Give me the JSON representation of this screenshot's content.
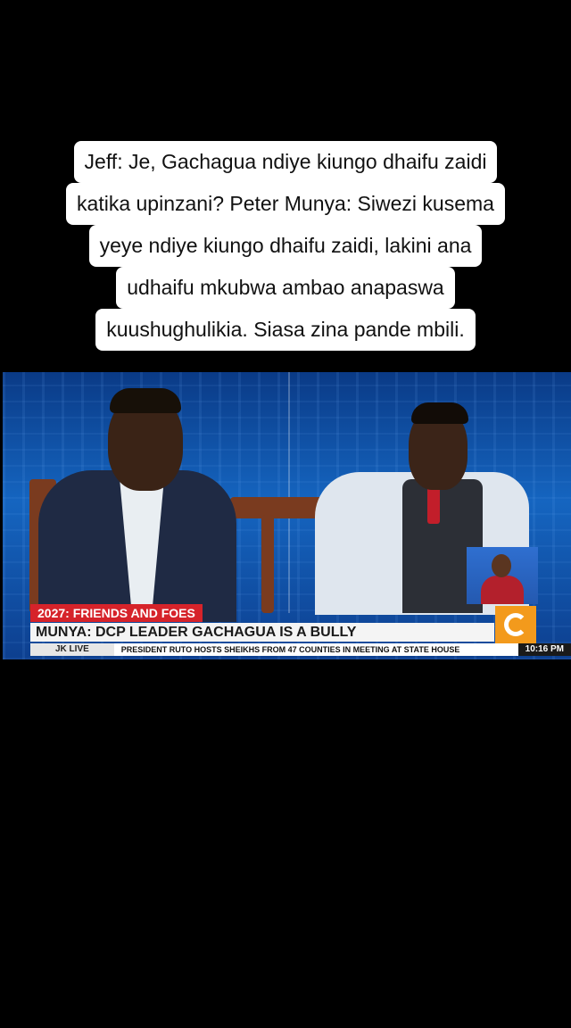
{
  "caption": {
    "lines": [
      "Jeff: Je, Gachagua ndiye kiungo dhaifu zaidi",
      "katika upinzani? Peter Munya: Siwezi kusema",
      "yeye ndiye kiungo dhaifu zaidi, lakini ana",
      "udhaifu mkubwa ambao anapaswa",
      "kuushughulikia. Siasa zina pande mbili."
    ]
  },
  "broadcast": {
    "tag": "2027: FRIENDS AND FOES",
    "headline": "MUNYA: DCP LEADER GACHAGUA IS A BULLY",
    "ticker_label": "JK LIVE",
    "ticker_text": "PRESIDENT RUTO HOSTS SHEIKHS FROM 47 COUNTIES IN MEETING AT STATE HOUSE",
    "time": "10:16 PM",
    "logo_icon": "channel-logo-icon",
    "colors": {
      "tag": "#d6232a",
      "logo": "#f39a1c",
      "studio": "#1565c0"
    }
  }
}
